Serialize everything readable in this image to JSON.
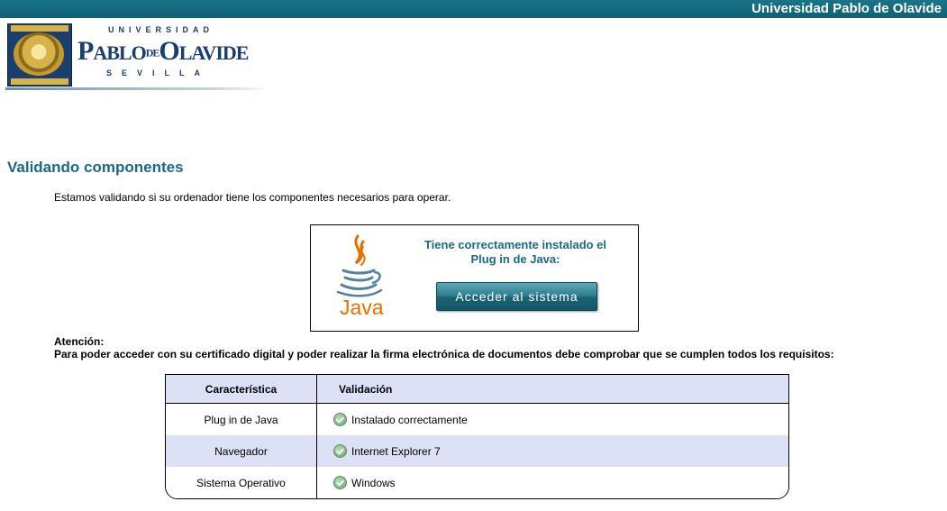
{
  "header": {
    "bar_title": "Universidad Pablo de Olavide",
    "logo": {
      "top_text": "UNIVERSIDAD",
      "main_text_p": "P",
      "main_text_ablo": "ABLO",
      "main_text_de": "DE",
      "main_text_o": "O",
      "main_text_lavide": "LAVIDE",
      "bottom_text": "SEVILLA",
      "seal_top_text": "UNIVERSIDAD",
      "seal_bottom_text": "PABLO DE OLAVIDE"
    }
  },
  "main": {
    "title": "Validando componentes",
    "intro": "Estamos validando si su ordenador tiene los componentes necesarios para operar.",
    "java_panel": {
      "logo_text": "Java",
      "message_line1": "Tiene correctamente instalado el",
      "message_line2": "Plug in de Java:",
      "button_label": "Acceder al sistema"
    },
    "attention": {
      "label": "Atención:",
      "text": "Para poder acceder con su certificado digital y poder realizar la firma electrónica de documentos debe comprobar que se cumplen todos los requisitos:"
    },
    "requirements": {
      "headers": [
        "Característica",
        "Validación"
      ],
      "rows": [
        {
          "feature": "Plug in de Java",
          "status": "Instalado correctamente",
          "icon": "check-icon"
        },
        {
          "feature": "Navegador",
          "status": "Internet Explorer 7",
          "icon": "check-icon"
        },
        {
          "feature": "Sistema Operativo",
          "status": "Windows",
          "icon": "check-icon"
        }
      ]
    }
  },
  "colors": {
    "top_bar": "#0f6579",
    "title": "#1a6a86",
    "row_highlight": "#dde1f5",
    "java_orange": "#e76f00",
    "logo_blue": "#1b3d70"
  }
}
